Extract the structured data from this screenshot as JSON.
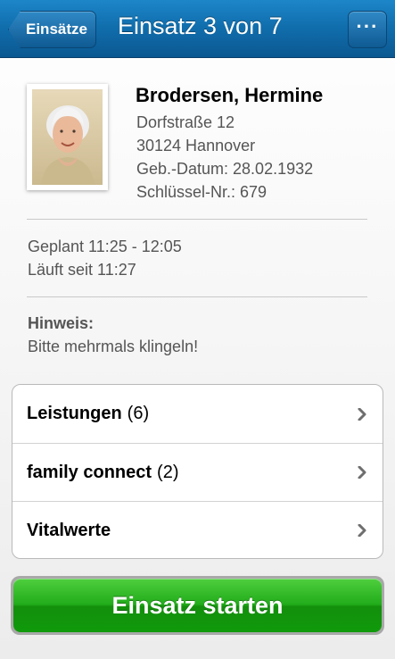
{
  "navbar": {
    "back_label": "Einsätze",
    "title": "Einsatz 3 von 7",
    "more_label": "···"
  },
  "patient": {
    "name": "Brodersen, Hermine",
    "street": "Dorfstraße 12",
    "city": "30124 Hannover",
    "birthdate": "Geb.-Datum: 28.02.1932",
    "key_no": "Schlüssel-Nr.: 679"
  },
  "schedule": {
    "planned": "Geplant 11:25 - 12:05",
    "running": "Läuft seit 11:27"
  },
  "hint": {
    "label": "Hinweis:",
    "text": "Bitte mehrmals klingeln!"
  },
  "list": {
    "items": [
      {
        "label": "Leistungen",
        "count": "(6)"
      },
      {
        "label": "family connect",
        "count": "(2)"
      },
      {
        "label": "Vitalwerte",
        "count": ""
      }
    ]
  },
  "start_button": {
    "label": "Einsatz starten"
  },
  "colors": {
    "navbar": "#116fae",
    "start_button": "#22ac1b"
  }
}
